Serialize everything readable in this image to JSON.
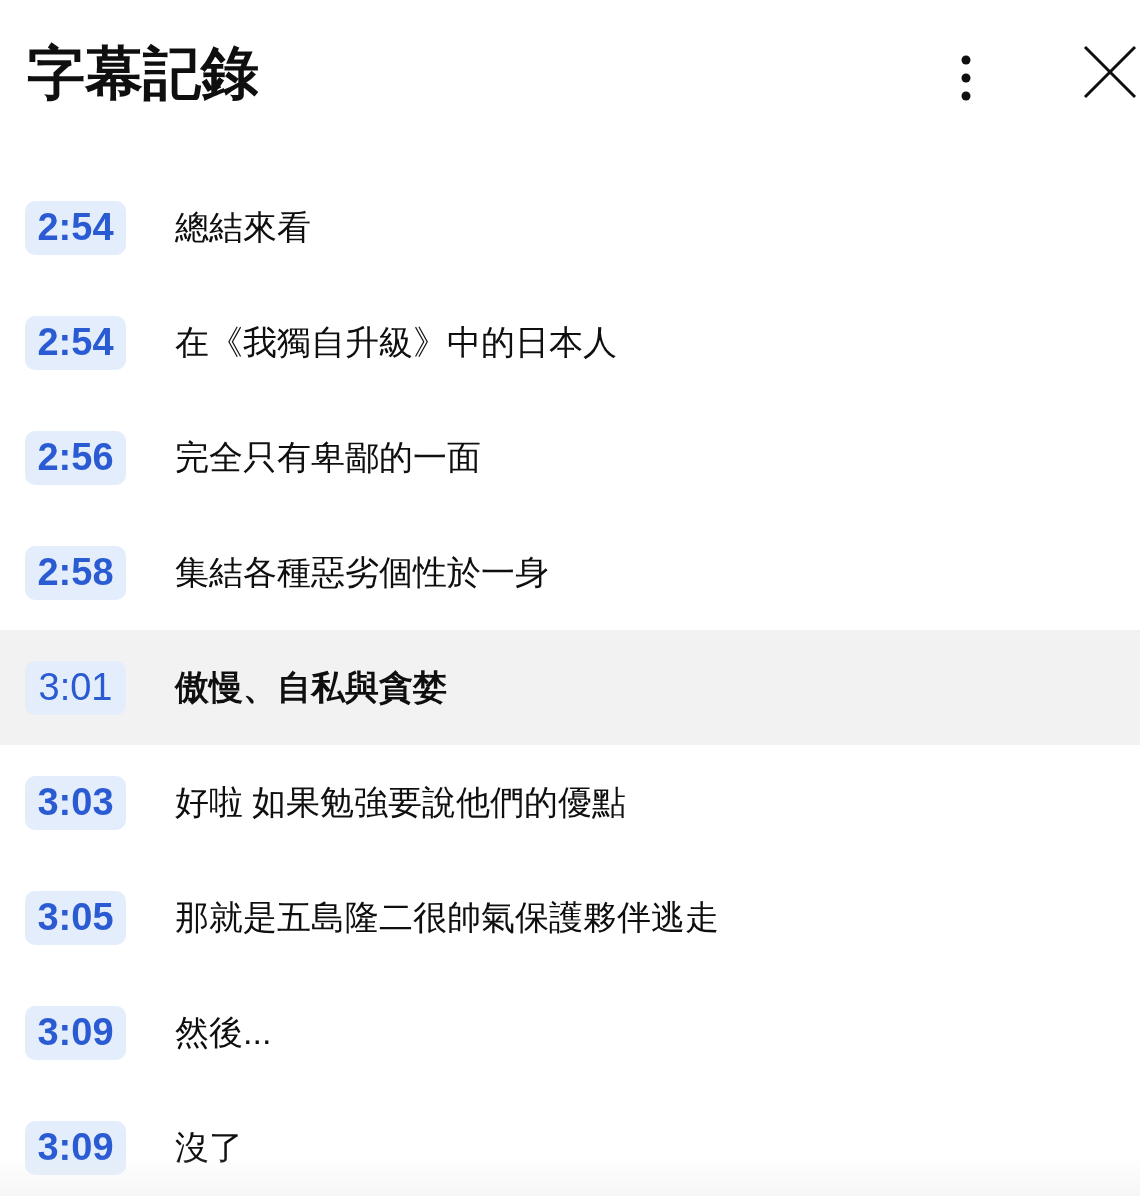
{
  "panel": {
    "title": "字幕記錄"
  },
  "segments": [
    {
      "time": "2:54",
      "text": "總結來看",
      "selected": false
    },
    {
      "time": "2:54",
      "text": "在《我獨自升級》中的日本人",
      "selected": false
    },
    {
      "time": "2:56",
      "text": "完全只有卑鄙的一面",
      "selected": false
    },
    {
      "time": "2:58",
      "text": "集結各種惡劣個性於一身",
      "selected": false
    },
    {
      "time": "3:01",
      "text": "傲慢、自私與貪婪",
      "selected": true
    },
    {
      "time": "3:03",
      "text": "好啦 如果勉強要說他們的優點",
      "selected": false
    },
    {
      "time": "3:05",
      "text": "那就是五島隆二很帥氣保護夥伴逃走",
      "selected": false
    },
    {
      "time": "3:09",
      "text": "然後...",
      "selected": false
    },
    {
      "time": "3:09",
      "text": "沒了",
      "selected": false
    }
  ]
}
